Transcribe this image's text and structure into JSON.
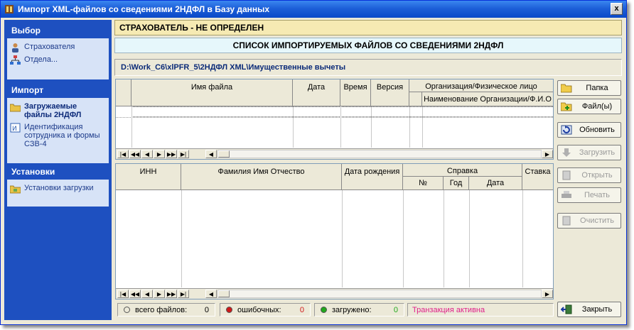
{
  "window": {
    "title": "Импорт XML-файлов со сведениями 2НДФЛ в Базу данных",
    "close_label": "x"
  },
  "sidebar": {
    "groups": [
      {
        "title": "Выбор",
        "items": [
          {
            "label": "Страхователя"
          },
          {
            "label": "Отдела..."
          }
        ]
      },
      {
        "title": "Импорт",
        "items": [
          {
            "label": "Загружаемые файлы 2НДФЛ"
          },
          {
            "label": "Идентификация сотрудника и формы СЗВ-4"
          }
        ]
      },
      {
        "title": "Установки",
        "items": [
          {
            "label": "Установки загрузки"
          }
        ]
      }
    ]
  },
  "header": {
    "status": "СТРАХОВАТЕЛЬ - НЕ ОПРЕДЕЛЕН",
    "list_title": "СПИСОК ИМПОРТИРУЕМЫХ ФАЙЛОВ СО СВЕДЕНИЯМИ 2НДФЛ",
    "path": "D:\\Work_C6\\xlPFR_5\\2НДФЛ XML\\Имущественные вычеты"
  },
  "files_grid": {
    "columns": {
      "filename": "Имя файла",
      "date": "Дата",
      "time": "Время",
      "version": "Версия",
      "org_group": "Организация/Физическое лицо",
      "org_name": "Наименование Организации/Ф.И.О"
    }
  },
  "people_grid": {
    "columns": {
      "inn": "ИНН",
      "fio": "Фамилия Имя Отчество",
      "birth": "Дата рождения",
      "spravka": "Справка",
      "num": "№",
      "year": "Год",
      "date": "Дата",
      "rate": "Ставка"
    }
  },
  "nav": {
    "first": "|◀",
    "prev_page": "◀◀",
    "prev": "◀",
    "next": "▶",
    "next_page": "▶▶",
    "last": "▶|",
    "scroll_left": "◀",
    "scroll_right": "▶"
  },
  "buttons": {
    "folder": "Папка",
    "files": "Файл(ы)",
    "refresh": "Обновить",
    "load": "Загрузить",
    "open": "Открыть",
    "print": "Печать",
    "clear": "Очистить",
    "close": "Закрыть"
  },
  "status": {
    "total_label": "всего файлов:",
    "total_value": "0",
    "errors_label": "ошибочных:",
    "errors_value": "0",
    "loaded_label": "загружено:",
    "loaded_value": "0",
    "transaction": "Транзакция активна"
  },
  "colors": {
    "title_bar": "#0a49c8",
    "sidebar": "#1e50c0",
    "header_bar": "#f6eab3",
    "transaction_text": "#e0208a",
    "error_dot": "#d01818",
    "ok_dot": "#21a81c"
  }
}
